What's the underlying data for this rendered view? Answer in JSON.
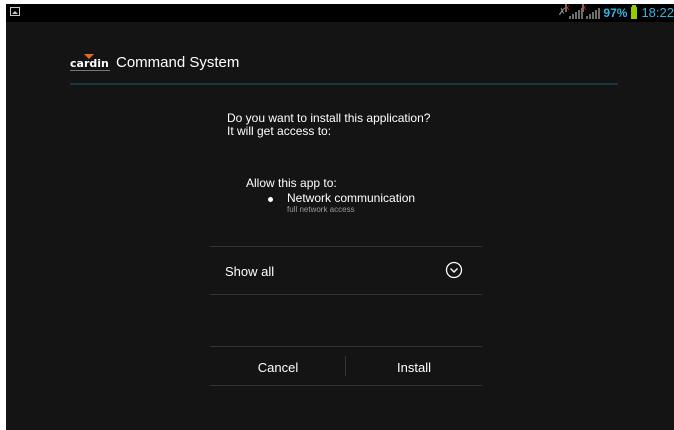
{
  "status_bar": {
    "icons": [
      "image-notification-icon",
      "mute-icon",
      "signal-no-sim-icon",
      "signal-icon",
      "battery-icon"
    ],
    "battery": "97%",
    "time": "18:22",
    "colors": {
      "accent": "#33b5e5",
      "battery": "#99cc00"
    }
  },
  "header": {
    "logo_text": "cardin",
    "title": "Command System"
  },
  "prompt": {
    "line1": "Do you want to install this application?",
    "line2": "It will get access to:"
  },
  "permissions": {
    "heading": "Allow this app to:",
    "items": [
      {
        "name": "Network communication",
        "description": "full network access"
      }
    ]
  },
  "show_all": {
    "label": "Show all",
    "icon": "chevron-down-circle-icon"
  },
  "buttons": {
    "cancel": "Cancel",
    "install": "Install"
  },
  "colors": {
    "background": "#141414",
    "divider": "#343434",
    "header_rule": "#123845"
  }
}
